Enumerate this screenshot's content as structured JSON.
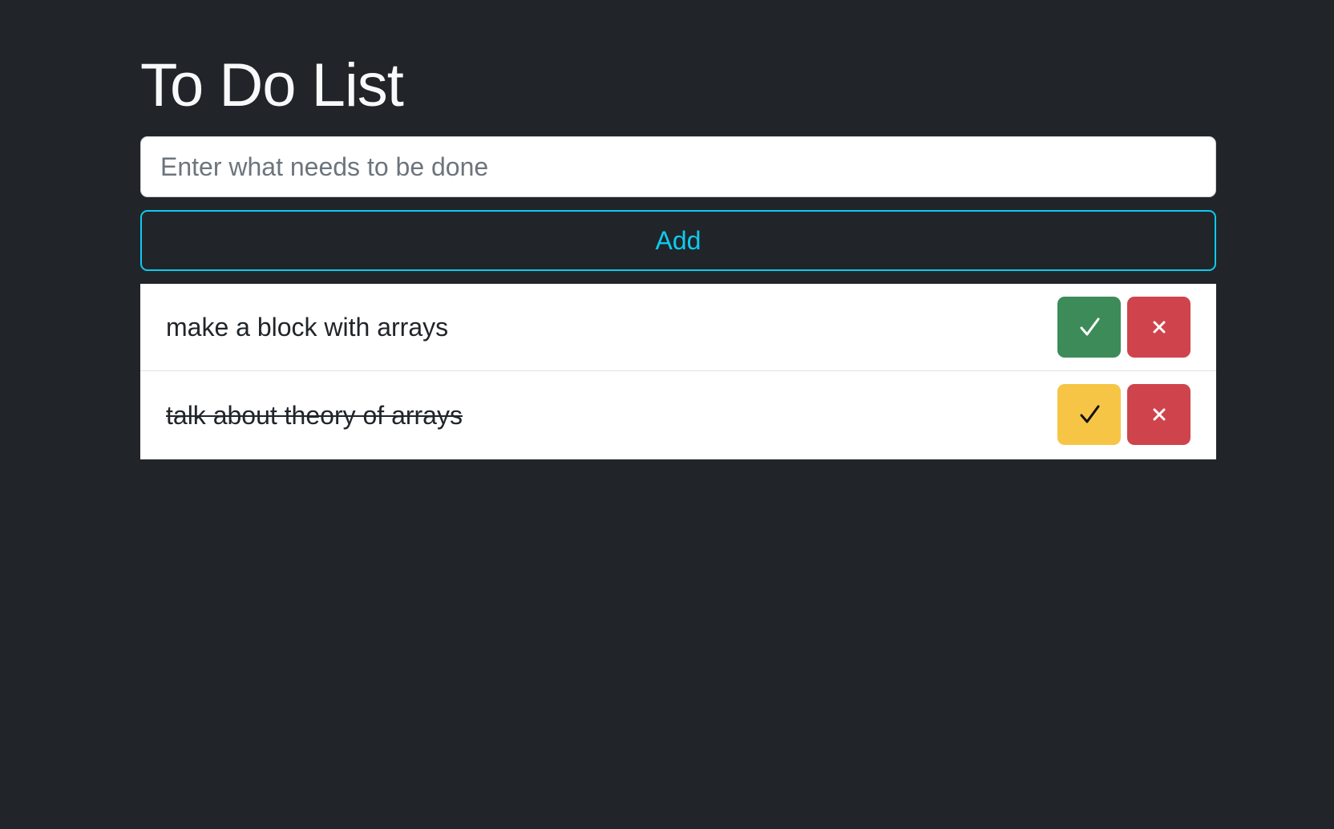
{
  "app": {
    "title": "To Do List"
  },
  "new_task": {
    "placeholder": "Enter what needs to be done",
    "value": ""
  },
  "add_button": {
    "label": "Add"
  },
  "todos": [
    {
      "text": "make a block with arrays",
      "completed": false,
      "toggle_icon": "check-icon",
      "delete_icon": "close-icon"
    },
    {
      "text": "talk about theory of arrays",
      "completed": true,
      "toggle_icon": "check-icon",
      "delete_icon": "close-icon"
    }
  ],
  "colors": {
    "background": "#212529",
    "accent": "#0dcaf0",
    "complete": "#3d8b59",
    "undo": "#f7c546",
    "delete": "#cf444c"
  }
}
